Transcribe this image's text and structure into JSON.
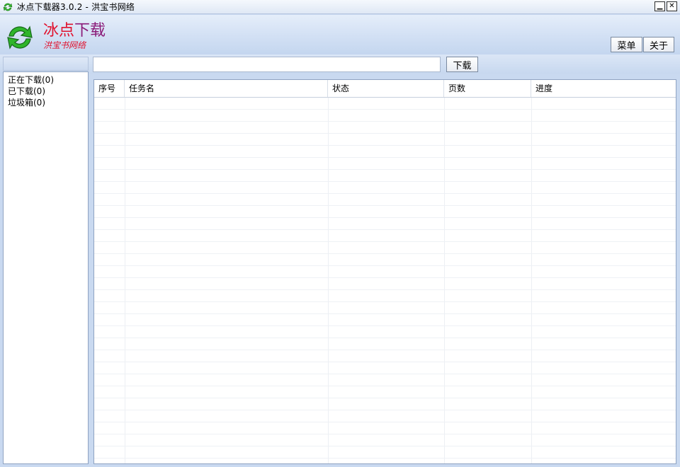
{
  "window": {
    "title": "冰点下载器3.0.2 - 洪宝书网络",
    "minimize_glyph": "▁",
    "close_glyph": "✕"
  },
  "header": {
    "logo_title_part1": "冰点",
    "logo_title_part2": "下载",
    "logo_subtitle": "洪宝书网络",
    "menu_button": "菜单",
    "about_button": "关于"
  },
  "toolbar": {
    "url_value": "",
    "download_button": "下载"
  },
  "sidebar": {
    "items": [
      {
        "label": "正在下载(0)"
      },
      {
        "label": "已下载(0)"
      },
      {
        "label": "垃圾箱(0)"
      }
    ]
  },
  "table": {
    "columns": [
      "序号",
      "任务名",
      "状态",
      "页数",
      "进度"
    ],
    "rows": []
  },
  "colors": {
    "brand_red": "#e0132f",
    "brand_purple": "#8a1a78",
    "logo_green": "#2fb52a"
  }
}
